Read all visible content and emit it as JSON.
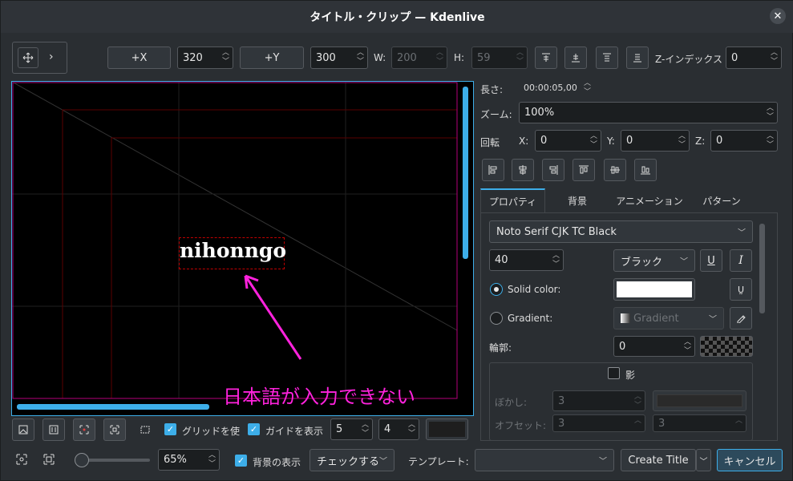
{
  "window": {
    "title": "タイトル・クリップ — Kdenlive",
    "close_glyph": "✕"
  },
  "toolbar": {
    "plus_x": "+X",
    "x_value": "320",
    "plus_y": "+Y",
    "y_value": "300",
    "w_label": "W:",
    "w_value": "200",
    "h_label": "H:",
    "h_value": "59",
    "z_index_label": "Z-インデックス",
    "z_index_value": "0"
  },
  "props": {
    "duration_label": "長さ:",
    "duration_value": "00:00:05,00",
    "zoom_label": "ズーム:",
    "zoom_value": "100%",
    "rotation_label": "回転",
    "rx_label": "X:",
    "rx_value": "0",
    "ry_label": "Y:",
    "ry_value": "0",
    "rz_label": "Z:",
    "rz_value": "0"
  },
  "tabs": [
    "プロパティ",
    "背景",
    "アニメーション",
    "パターン"
  ],
  "font": {
    "family": "Noto Serif CJK TC Black",
    "size": "40",
    "weight": "ブラック",
    "underline": "U",
    "italic": "I",
    "caps": "Ṵ"
  },
  "color": {
    "solid_label": "Solid color:",
    "gradient_label": "Gradient:",
    "gradient_value": "Gradient",
    "outline_label": "輪郭:",
    "outline_value": "0",
    "solid_hex": "#ffffff"
  },
  "shadow": {
    "label": "影",
    "blur_label": "ぼかし:",
    "blur_value": "3",
    "offset_label": "オフセット:",
    "offset_x": "3",
    "offset_y": "3"
  },
  "canvas": {
    "text": "nihonngo",
    "annotation": "日本語が入力できない",
    "annotation_color": "#ff22dd"
  },
  "bottom": {
    "grid_label": "グリッドを使",
    "guides_label": "ガイドを表示",
    "guide_h": "5",
    "guide_v": "4",
    "zoom_percent": "65%",
    "zoom_slider_fraction": 0.1,
    "show_bg_label": "背景の表示",
    "checker_label": "チェックする",
    "template_label": "テンプレート:",
    "template_value": "",
    "create_title": "Create Title",
    "cancel": "キャンセル"
  },
  "colors": {
    "accent": "#3daee9",
    "bg": "#2a2e32"
  }
}
